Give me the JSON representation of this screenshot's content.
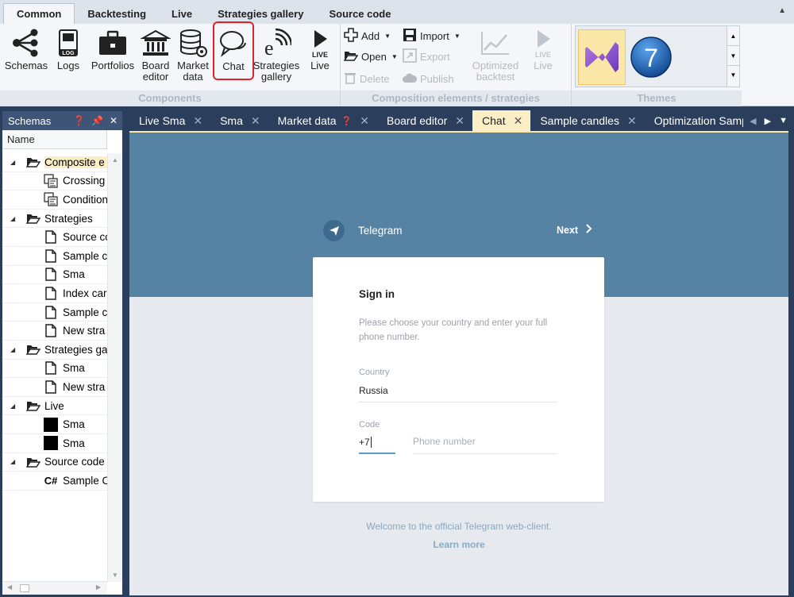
{
  "ribbon_tabs": [
    "Common",
    "Backtesting",
    "Live",
    "Strategies gallery",
    "Source code"
  ],
  "components": {
    "buttons": [
      {
        "label": "Schemas",
        "icon": "schemas-icon"
      },
      {
        "label": "Logs",
        "icon": "log-icon"
      },
      {
        "label": "Portfolios",
        "icon": "briefcase-icon"
      },
      {
        "label": "Board editor",
        "icon": "bank-icon"
      },
      {
        "label": "Market data",
        "icon": "database-gear-icon"
      },
      {
        "label": "Chat",
        "icon": "chat-bubbles-icon"
      },
      {
        "label": "Strategies gallery",
        "icon": "strategies-gallery-icon"
      },
      {
        "label": "Live",
        "icon": "live-play-icon"
      }
    ],
    "label": "Components"
  },
  "composition": {
    "add": "Add",
    "open": "Open",
    "delete": "Delete",
    "import": "Import",
    "export": "Export",
    "publish": "Publish",
    "optimized_backtest": "Optimized backtest",
    "live": "Live",
    "live_badge": "LIVE",
    "label": "Composition elements / strategies"
  },
  "themes": {
    "label": "Themes",
    "item2": "7"
  },
  "schemas_panel": {
    "title": "Schemas",
    "column": "Name",
    "tree": [
      {
        "level": 0,
        "label": "Composite e",
        "icon": "folder-open-icon",
        "expander": true,
        "selected": true
      },
      {
        "level": 1,
        "label": "Crossing",
        "icon": "composite-icon"
      },
      {
        "level": 1,
        "label": "Condition",
        "icon": "composite-icon"
      },
      {
        "level": 0,
        "label": "Strategies",
        "icon": "folder-open-icon",
        "expander": true
      },
      {
        "level": 1,
        "label": "Source co",
        "icon": "document-icon"
      },
      {
        "level": 1,
        "label": "Sample c",
        "icon": "document-icon"
      },
      {
        "level": 1,
        "label": "Sma",
        "icon": "document-icon"
      },
      {
        "level": 1,
        "label": "Index car",
        "icon": "document-icon"
      },
      {
        "level": 1,
        "label": "Sample c",
        "icon": "document-icon"
      },
      {
        "level": 1,
        "label": "New stra",
        "icon": "document-icon"
      },
      {
        "level": 0,
        "label": "Strategies ga",
        "icon": "folder-open-icon",
        "expander": true
      },
      {
        "level": 1,
        "label": "Sma",
        "icon": "document-icon"
      },
      {
        "level": 1,
        "label": "New stra",
        "icon": "document-icon"
      },
      {
        "level": 0,
        "label": "Live",
        "icon": "folder-open-icon",
        "expander": true
      },
      {
        "level": 1,
        "label": "Sma",
        "icon": "black-square-icon"
      },
      {
        "level": 1,
        "label": "Sma",
        "icon": "black-square-icon"
      },
      {
        "level": 0,
        "label": "Source code",
        "icon": "folder-open-icon",
        "expander": true
      },
      {
        "level": 1,
        "label": "Sample C",
        "icon": "csharp-icon"
      }
    ]
  },
  "doc_tabs": [
    {
      "label": "Live Sma",
      "help": false,
      "active": false
    },
    {
      "label": "Sma",
      "help": false,
      "active": false
    },
    {
      "label": "Market data",
      "help": true,
      "active": false
    },
    {
      "label": "Board editor",
      "help": false,
      "active": false
    },
    {
      "label": "Chat",
      "help": false,
      "active": true
    },
    {
      "label": "Sample candles",
      "help": false,
      "active": false
    },
    {
      "label": "Optimization Sample cand",
      "help": false,
      "active": false
    }
  ],
  "telegram": {
    "brand": "Telegram",
    "next": "Next",
    "sign_in": "Sign in",
    "desc": "Please choose your country and enter your full phone number.",
    "country_label": "Country",
    "country_value": "Russia",
    "code_label": "Code",
    "code_value": "+7",
    "phone_placeholder": "Phone number",
    "welcome": "Welcome to the official Telegram web-client.",
    "learn_more": "Learn more"
  }
}
